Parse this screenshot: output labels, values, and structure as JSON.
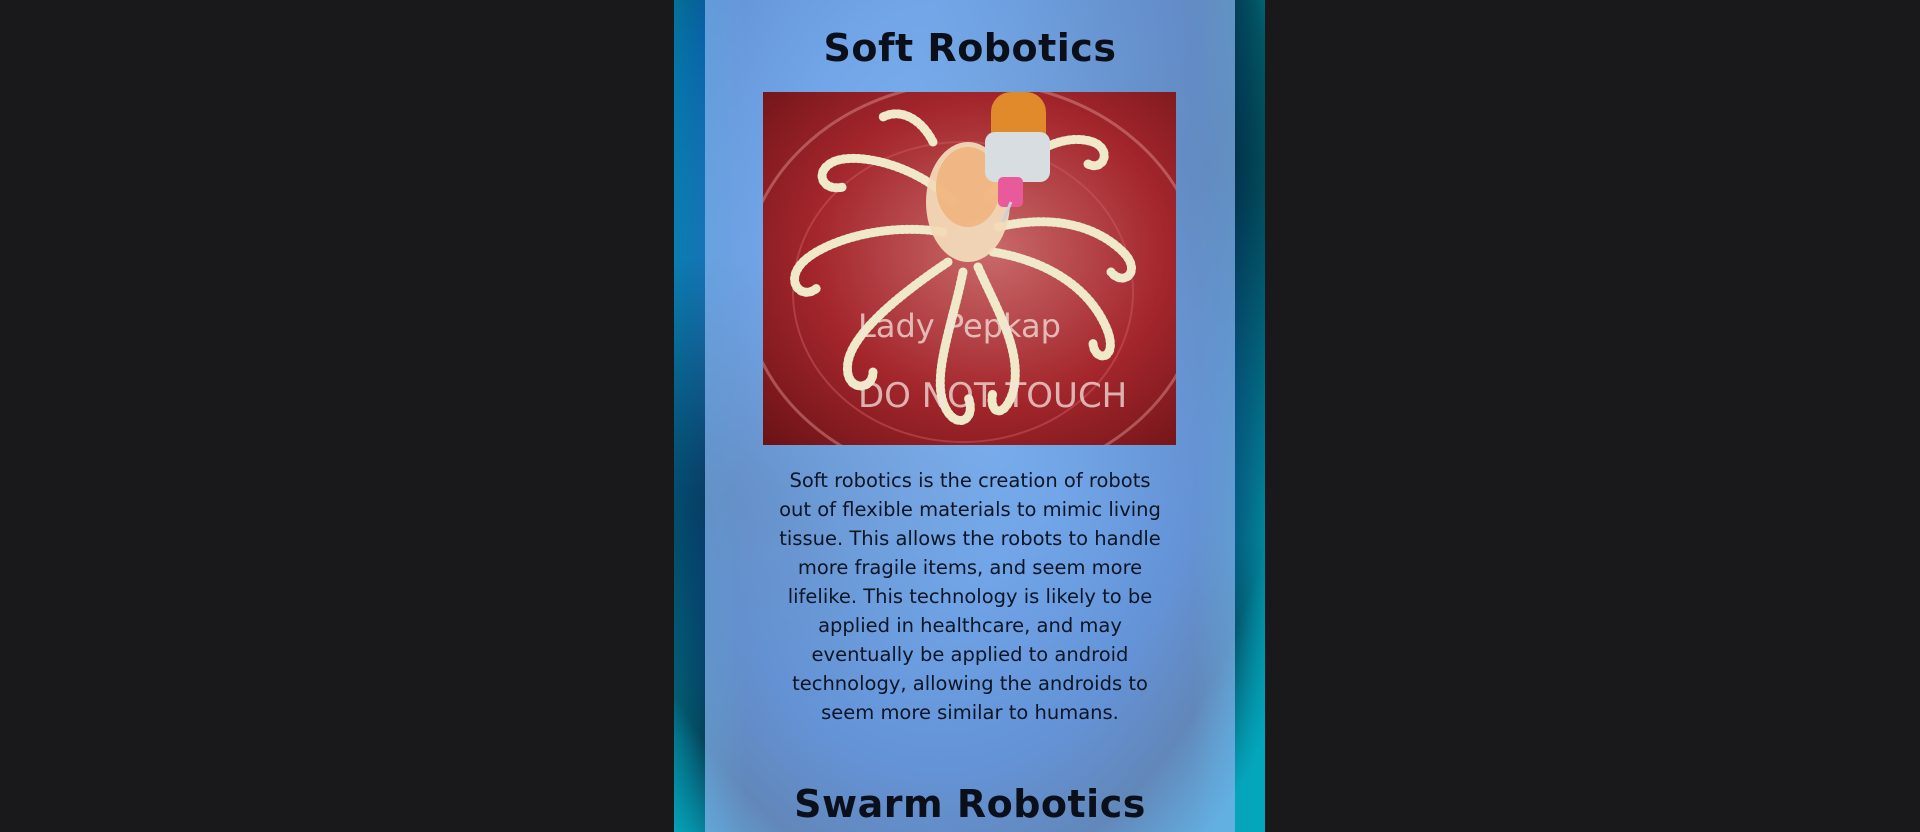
{
  "sections": [
    {
      "title": "Soft Robotics",
      "image_alt": "3D printed soft octopus robot in a petri dish",
      "image_dish_text_1": "Lady Pepkap",
      "image_dish_text_2": "DO NOT TOUCH",
      "body": "Soft robotics is the creation of robots out of flexible materials to mimic living tissue. This allows the robots to handle more fragile items, and seem more lifelike. This technology is likely to be applied in healthcare, and may eventually be applied to android technology, allowing the androids to seem more similar to humans."
    },
    {
      "title": "Swarm Robotics"
    }
  ],
  "colors": {
    "page_background": "#19191b",
    "column_overlay": "#87b4f0",
    "heading_text": "#0a0f1a",
    "body_text": "#0d1526",
    "dish_red": "#a3262c",
    "octopus_cream": "#efe9c9",
    "accent_teal": "#0a9fb8"
  }
}
